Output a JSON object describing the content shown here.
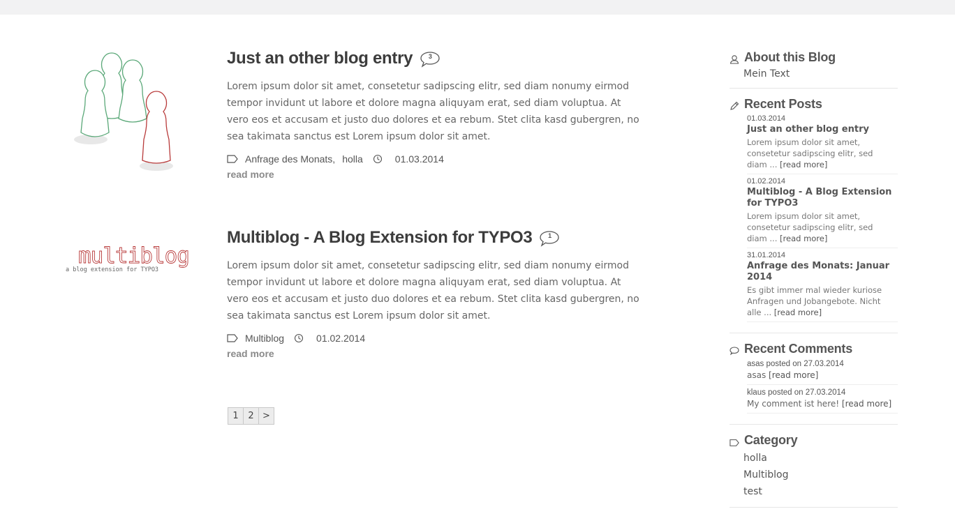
{
  "posts": [
    {
      "title": "Just an other blog entry",
      "comments": "3",
      "teaser": "Lorem ipsum dolor sit amet, consetetur sadipscing elitr, sed diam nonumy eirmod tempor invidunt ut labore et dolore magna aliquyam erat, sed diam voluptua. At vero eos et accusam et justo duo dolores et ea rebum. Stet clita kasd gubergren, no sea takimata sanctus est Lorem ipsum dolor sit amet.",
      "tags": [
        "Anfrage des Monats",
        "holla"
      ],
      "date": "01.03.2014",
      "read_more": "read more"
    },
    {
      "title": "Multiblog - A Blog Extension for TYPO3",
      "comments": "1",
      "teaser": "Lorem ipsum dolor sit amet, consetetur sadipscing elitr, sed diam nonumy eirmod tempor invidunt ut labore et dolore magna aliquyam erat, sed diam voluptua. At vero eos et accusam et justo duo dolores et ea rebum. Stet clita kasd gubergren, no sea takimata sanctus est Lorem ipsum dolor sit amet.",
      "tags": [
        "Multiblog"
      ],
      "date": "01.02.2014",
      "read_more": "read more",
      "logo_text": "multiblog",
      "logo_sub": "a blog extension for TYPO3"
    }
  ],
  "tag_separator": ",",
  "pagination": [
    "1",
    "2",
    ">"
  ],
  "sidebar": {
    "about": {
      "title": "About this Blog",
      "text": "Mein Text"
    },
    "recent_posts": {
      "title": "Recent Posts",
      "items": [
        {
          "date": "01.03.2014",
          "title": "Just an other blog entry",
          "excerpt": "Lorem ipsum dolor sit amet, consetetur sadipscing elitr, sed diam ...",
          "read_more": "[read more]"
        },
        {
          "date": "01.02.2014",
          "title": "Multiblog - A Blog Extension for TYPO3",
          "excerpt": "Lorem ipsum dolor sit amet, consetetur sadipscing elitr, sed diam ...",
          "read_more": "[read more]"
        },
        {
          "date": "31.01.2014",
          "title": "Anfrage des Monats: Januar 2014",
          "excerpt": "Es gibt immer mal wieder kuriose Anfragen und Jobangebote. Nicht alle ...",
          "read_more": "[read more]"
        }
      ]
    },
    "recent_comments": {
      "title": "Recent Comments",
      "items": [
        {
          "header": "asas posted on 27.03.2014",
          "text": "asas",
          "read_more": "[read more]"
        },
        {
          "header": "klaus posted on 27.03.2014",
          "text": "My comment ist here!",
          "read_more": "[read more]"
        }
      ]
    },
    "category": {
      "title": "Category",
      "items": [
        "holla",
        "Multiblog",
        "test"
      ]
    }
  }
}
